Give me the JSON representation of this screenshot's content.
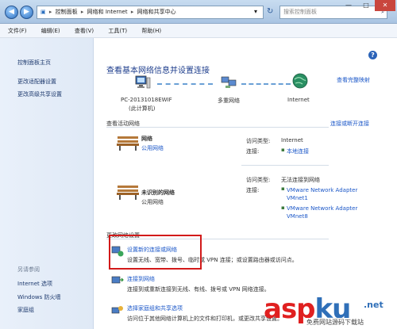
{
  "address": {
    "crumbs": [
      "控制面板",
      "网络和 Internet",
      "网络和共享中心"
    ],
    "dropdown_arrow": "▾",
    "refresh": "↻"
  },
  "search": {
    "placeholder": "搜索控制面板"
  },
  "window_controls": {
    "minimize": "—",
    "maximize": "□",
    "close": "✕"
  },
  "menu": [
    "文件(F)",
    "编辑(E)",
    "查看(V)",
    "工具(T)",
    "帮助(H)"
  ],
  "sidebar": {
    "items": [
      "控制面板主页",
      "更改适配器设置",
      "更改高级共享设置"
    ],
    "see_also_heading": "另请参阅",
    "see_also": [
      "Internet 选项",
      "Windows 防火墙",
      "家庭组"
    ]
  },
  "main": {
    "title": "查看基本网络信息并设置连接",
    "view_full_map": "查看完整映射",
    "map": {
      "computer_name": "PC-20131018EWIF",
      "computer_sub": "(此计算机)",
      "middle": "多重网络",
      "right": "Internet"
    },
    "active_heading": "查看活动网络",
    "connect_disconnect": "连接或断开连接",
    "network1": {
      "name": "网络",
      "type": "公用网络",
      "access_label": "访问类型:",
      "access_value": "Internet",
      "conn_label": "连接:",
      "conn_value": "本地连接"
    },
    "network2": {
      "name": "未识别的网络",
      "type": "公用网络",
      "access_label": "访问类型:",
      "access_value": "无法连接到网络",
      "conn_label": "连接:",
      "conn_values": [
        "VMware Network Adapter VMnet1",
        "VMware Network Adapter VMnet8"
      ]
    },
    "change_heading": "更改网络设置",
    "tasks": [
      {
        "title": "设置新的连接或网络",
        "desc": "设置无线、宽带、拨号、临时或 VPN 连接；或设置路由器或访问点。"
      },
      {
        "title": "连接到网络",
        "desc": "连接到或重新连接到无线、有线、拨号或 VPN 网络连接。"
      },
      {
        "title": "选择家庭组和共享选项",
        "desc": "访问位于其他网络计算机上的文件和打印机，或更改共享设置。"
      }
    ]
  },
  "watermark": {
    "asp": "asp",
    "ku": "ku",
    "net": ".net",
    "sub": "免费网站源码下载站"
  }
}
